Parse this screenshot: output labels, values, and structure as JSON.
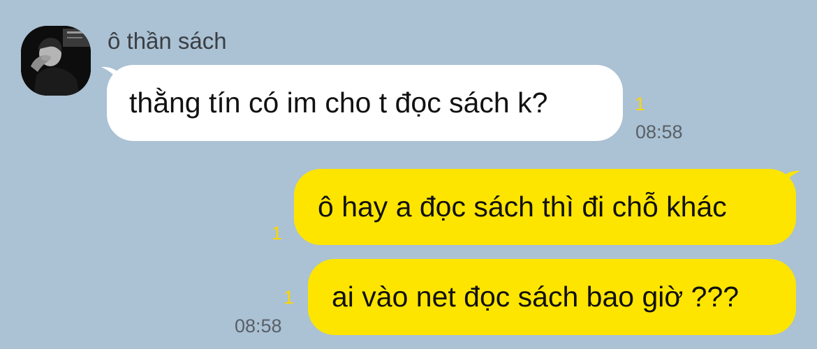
{
  "chat": {
    "sender_name": "ô thần sách",
    "messages": [
      {
        "text": "thằng tín có im cho t đọc sách k?",
        "unread": "1",
        "time": "08:58"
      },
      {
        "text": "ô hay a đọc sách thì đi chỗ khác",
        "unread": "1"
      },
      {
        "text": "ai vào net đọc sách bao giờ ???",
        "unread": "1",
        "time": "08:58"
      }
    ]
  },
  "colors": {
    "background": "#abc1d4",
    "incoming_bubble": "#ffffff",
    "outgoing_bubble": "#fee500",
    "unread_count": "#fcd600",
    "timestamp": "#596066"
  },
  "icons": {
    "avatar": "user-avatar-photo"
  }
}
